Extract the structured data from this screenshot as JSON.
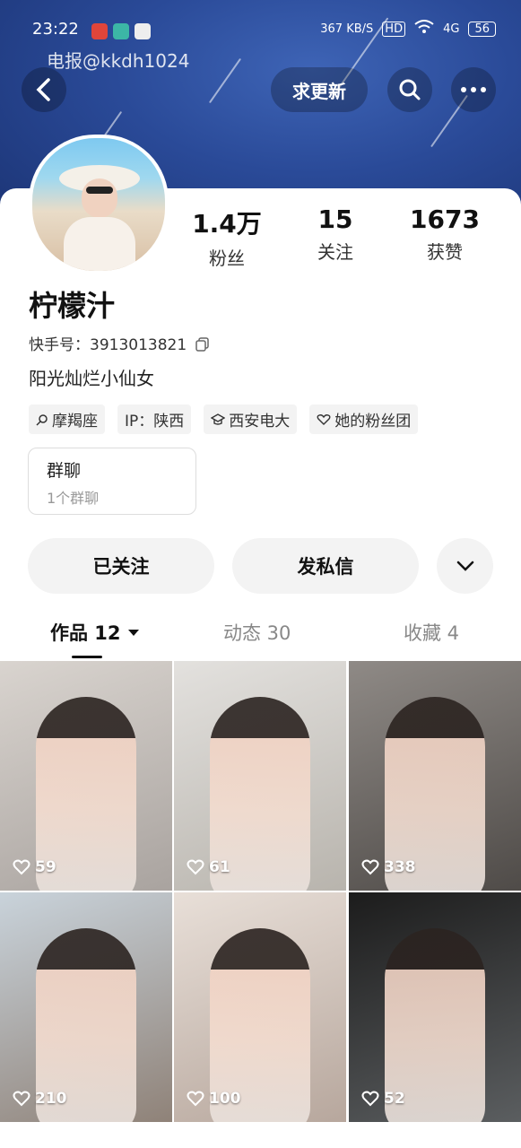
{
  "status_bar": {
    "time": "23:22",
    "net_speed": "367 KB/S",
    "hd": "HD",
    "signal": "4G",
    "battery": "56"
  },
  "watermark": "电报@kkdh1024",
  "header": {
    "update_button": "求更新"
  },
  "profile": {
    "name": "柠檬汁",
    "kuaishou_id": "快手号：3913013821",
    "bio": "阳光灿烂小仙女",
    "stats": [
      {
        "value": "1.4万",
        "label": "粉丝"
      },
      {
        "value": "15",
        "label": "关注"
      },
      {
        "value": "1673",
        "label": "获赞"
      }
    ],
    "tags": [
      "摩羯座",
      "IP：陕西",
      "西安电大",
      "她的粉丝团"
    ],
    "group": {
      "title": "群聊",
      "subtitle": "1个群聊"
    }
  },
  "actions": {
    "follow": "已关注",
    "message": "发私信"
  },
  "tabs": [
    "作品 12",
    "动态 30",
    "收藏 4"
  ],
  "videos": [
    {
      "likes": "59"
    },
    {
      "likes": "61"
    },
    {
      "likes": "338"
    },
    {
      "likes": "210"
    },
    {
      "likes": "100"
    },
    {
      "likes": "52"
    }
  ],
  "colors": {
    "header": "#2a4a98",
    "like_icon": "#ffffff"
  }
}
